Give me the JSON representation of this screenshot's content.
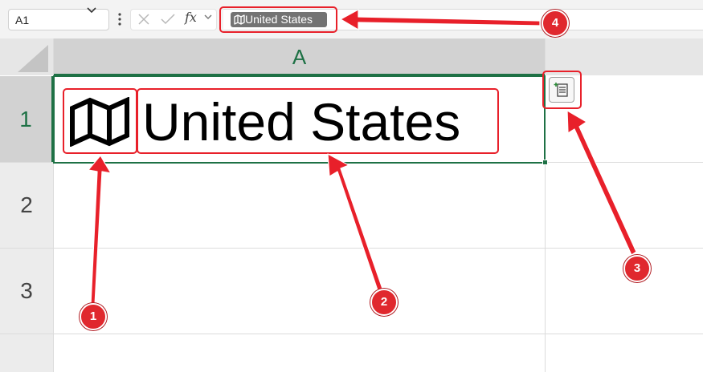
{
  "formula_bar": {
    "name_box": "A1",
    "fx_label": "fx",
    "formula_value": "United States"
  },
  "grid": {
    "column_headers": [
      "A"
    ],
    "row_headers": [
      "1",
      "2",
      "3"
    ],
    "selected_cell": "A1"
  },
  "cell_a1": {
    "icon": "map-icon",
    "text": "United States"
  },
  "insert_data_button": {
    "icon": "insert-data-icon"
  },
  "annotations": {
    "badges": [
      "1",
      "2",
      "3",
      "4"
    ],
    "color": "#e8202a"
  },
  "colors": {
    "excel_green": "#1e7145",
    "header_selected": "#d2d2d2",
    "header": "#e6e6e6",
    "gridline": "#dcdcdc"
  }
}
